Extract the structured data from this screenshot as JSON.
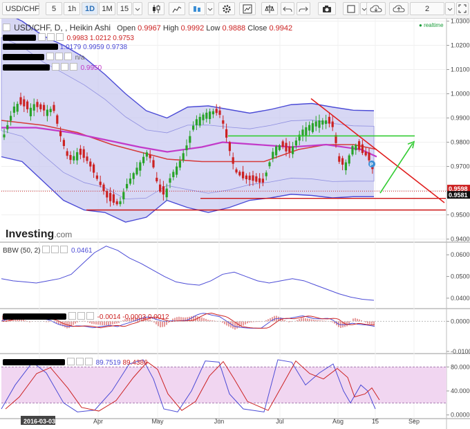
{
  "toolbar": {
    "symbol": "USD/CHF",
    "timeframes": [
      "5",
      "1h",
      "1D",
      "1M",
      "15"
    ],
    "active_timeframe": "1D",
    "layout_count": "2",
    "icons": [
      "dropdown-icon",
      "candles-icon",
      "area-chart-icon",
      "bar-chart-icon",
      "settings-icon",
      "indicators-icon",
      "balance-icon",
      "undo-icon",
      "redo-icon",
      "camera-icon",
      "color-icon",
      "cloud-download-icon",
      "cloud-upload-icon",
      "chevron-down-icon",
      "fullscreen-icon"
    ]
  },
  "legend": {
    "main": {
      "title": "USD/CHF, D, , Heikin Ashi",
      "open_label": "Open",
      "open": "0.9967",
      "high_label": "High",
      "high": "0.9992",
      "low_label": "Low",
      "low": "0.9888",
      "close_label": "Close",
      "close": "0.9942"
    },
    "bb1": "0.9983 1.0212 0.9753",
    "bb2": "1.0179 0.9959 0.9738",
    "ind3": "n/a",
    "ind4": "0.9950",
    "bbw_title": "BBW (50, 2)",
    "bbw_value": "0.0461",
    "macd_values": "-0.0014 -0.0003 0.0012",
    "stoch_values": [
      "89.7519",
      "89.4386"
    ],
    "realtime": "realtime"
  },
  "logo": {
    "brand": "Investing",
    "suffix": ".com"
  },
  "colors": {
    "up": "#29a329",
    "down": "#cc2222",
    "bb_outer": "#4b4bd6",
    "ma_red": "#d63a3a",
    "ma_magenta": "#c23ac9",
    "green_line": "#33cc33",
    "red_trend": "#e01e1e",
    "stoch_band": "#f1d6f1"
  },
  "chart_data": [
    {
      "type": "candlestick",
      "title": "USD/CHF, D, , Heikin Ashi",
      "x_ticks": [
        "2016-03-03",
        "Apr",
        "May",
        "Jun",
        "Jul",
        "Aug",
        "15",
        "Sep"
      ],
      "y_ticks": [
        "1.0300",
        "1.0200",
        "1.0100",
        "1.0000",
        "0.9900",
        "0.9800",
        "0.9700",
        "0.9600",
        "0.9500",
        "0.9400"
      ],
      "ylim": [
        0.939,
        1.031
      ],
      "price_labels": [
        "0.9598",
        "0.9581"
      ],
      "horizontal_levels": [
        0.9826,
        0.9568,
        0.952
      ],
      "trendline": {
        "from": [
          "Jul 28",
          0.998
        ],
        "to": [
          "Sep 15",
          0.955
        ]
      },
      "bollinger_outer": {
        "upper": [
          1.034,
          1.03,
          1.024,
          1.02,
          1.015,
          1.008,
          1.0,
          0.993,
          0.99,
          0.9945,
          0.995,
          0.9935,
          0.992,
          0.9935,
          0.9955,
          0.996,
          0.9945,
          0.9932,
          0.993
        ],
        "lower": [
          0.974,
          0.972,
          0.964,
          0.956,
          0.952,
          0.951,
          0.947,
          0.949,
          0.956,
          0.953,
          0.951,
          0.953,
          0.956,
          0.957,
          0.9585,
          0.958,
          0.957,
          0.9575,
          0.9575
        ]
      },
      "ohlc_recent": {
        "open": 0.9967,
        "high": 0.9992,
        "low": 0.9888,
        "close": 0.9942
      }
    },
    {
      "type": "line",
      "title": "BBW (50, 2)",
      "y_ticks": [
        "0.0600",
        "0.0500",
        "0.0400"
      ],
      "ylim": [
        0.0355,
        0.0655
      ],
      "values": [
        0.049,
        0.048,
        0.0475,
        0.047,
        0.048,
        0.049,
        0.051,
        0.056,
        0.061,
        0.064,
        0.062,
        0.0585,
        0.056,
        0.053,
        0.05,
        0.0475,
        0.0465,
        0.046,
        0.048,
        0.051,
        0.052,
        0.05,
        0.048,
        0.047,
        0.048,
        0.049,
        0.048,
        0.046,
        0.044,
        0.042,
        0.0405,
        0.0395,
        0.039
      ]
    },
    {
      "type": "bar",
      "title": "MACD",
      "y_ticks": [
        "0.0000",
        "-0.0100"
      ],
      "values": [
        "-0.0014",
        "-0.0003",
        "0.0012"
      ]
    },
    {
      "type": "line",
      "title": "Stochastic",
      "y_ticks": [
        "80.0000",
        "40.0000",
        "0.0000"
      ],
      "ylim": [
        -5,
        100
      ],
      "values": [
        "89.7519",
        "89.4386"
      ]
    }
  ]
}
